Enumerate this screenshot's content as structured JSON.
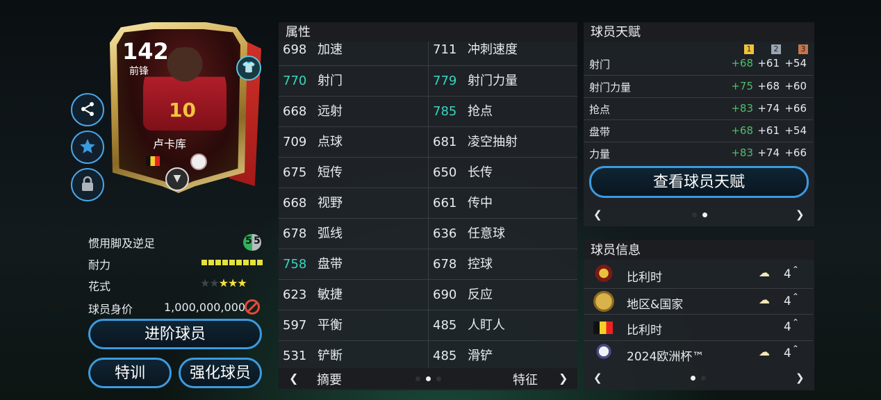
{
  "card": {
    "rating": "142",
    "position": "前锋",
    "name": "卢卡库",
    "jersey_number": "10",
    "icons": [
      "share-icon",
      "star-icon",
      "lock-icon",
      "shirt-icon",
      "chemistry-badge-icon"
    ]
  },
  "player_stats": {
    "weak_foot_label": "惯用脚及逆足",
    "weak_foot_left": "5",
    "weak_foot_right": "5",
    "stamina_label": "耐力",
    "stamina_level": 1.0,
    "skill_label": "花式",
    "skill_stars": 3,
    "skill_stars_max": 5,
    "value_label": "球员身价",
    "value": "1,000,000,000"
  },
  "buttons": {
    "upgrade": "进阶球员",
    "training": "特训",
    "enhance": "强化球员",
    "view_talent": "查看球员天赋"
  },
  "attributes": {
    "title": "属性",
    "rows": [
      {
        "l_num": "698",
        "l_name": "加速",
        "r_num": "711",
        "r_name": "冲刺速度",
        "l_hl": false,
        "r_hl": false
      },
      {
        "l_num": "770",
        "l_name": "射门",
        "r_num": "779",
        "r_name": "射门力量",
        "l_hl": true,
        "r_hl": true
      },
      {
        "l_num": "668",
        "l_name": "远射",
        "r_num": "785",
        "r_name": "抢点",
        "l_hl": false,
        "r_hl": true
      },
      {
        "l_num": "709",
        "l_name": "点球",
        "r_num": "681",
        "r_name": "凌空抽射",
        "l_hl": false,
        "r_hl": false
      },
      {
        "l_num": "675",
        "l_name": "短传",
        "r_num": "650",
        "r_name": "长传",
        "l_hl": false,
        "r_hl": false
      },
      {
        "l_num": "668",
        "l_name": "视野",
        "r_num": "661",
        "r_name": "传中",
        "l_hl": false,
        "r_hl": false
      },
      {
        "l_num": "678",
        "l_name": "弧线",
        "r_num": "636",
        "r_name": "任意球",
        "l_hl": false,
        "r_hl": false
      },
      {
        "l_num": "758",
        "l_name": "盘带",
        "r_num": "678",
        "r_name": "控球",
        "l_hl": true,
        "r_hl": false
      },
      {
        "l_num": "623",
        "l_name": "敏捷",
        "r_num": "690",
        "r_name": "反应",
        "l_hl": false,
        "r_hl": false
      },
      {
        "l_num": "597",
        "l_name": "平衡",
        "r_num": "485",
        "r_name": "人盯人",
        "l_hl": false,
        "r_hl": false
      },
      {
        "l_num": "531",
        "l_name": "铲断",
        "r_num": "485",
        "r_name": "滑铲",
        "l_hl": false,
        "r_hl": false
      }
    ],
    "footer_left": "摘要",
    "footer_right": "特征",
    "prev_arrow": "❮",
    "next_arrow": "❯"
  },
  "talent": {
    "title": "球员天赋",
    "tiers": [
      "1",
      "2",
      "3"
    ],
    "tier_colors": [
      "#f2c23a",
      "#9aa6b2",
      "#c8744a"
    ],
    "rows": [
      {
        "name": "射门",
        "v1": "+68",
        "v2": "+61",
        "v3": "+54"
      },
      {
        "name": "射门力量",
        "v1": "+75",
        "v2": "+68",
        "v3": "+60"
      },
      {
        "name": "抢点",
        "v1": "+83",
        "v2": "+74",
        "v3": "+66"
      },
      {
        "name": "盘带",
        "v1": "+68",
        "v2": "+61",
        "v3": "+54"
      },
      {
        "name": "力量",
        "v1": "+83",
        "v2": "+74",
        "v3": "+66"
      }
    ],
    "prev_arrow": "❮",
    "next_arrow": "❯"
  },
  "player_info": {
    "title": "球员信息",
    "rows": [
      {
        "label": "比利时",
        "count": "4",
        "has_chem": true,
        "icon": "belgium-crest-icon"
      },
      {
        "label": "地区&国家",
        "count": "4",
        "has_chem": true,
        "icon": "region-globe-icon"
      },
      {
        "label": "比利时",
        "count": "4",
        "has_chem": false,
        "icon": "belgium-flag-icon"
      },
      {
        "label": "2024欧洲杯™",
        "count": "4",
        "has_chem": true,
        "icon": "euro2024-logo-icon"
      }
    ],
    "prev_arrow": "❮",
    "next_arrow": "❯"
  },
  "colors": {
    "accent_blue": "#3b9be0",
    "highlight_teal": "#38d6c0",
    "talent_green": "#4fbf6a",
    "stamina_yellow": "#e6e23a"
  }
}
